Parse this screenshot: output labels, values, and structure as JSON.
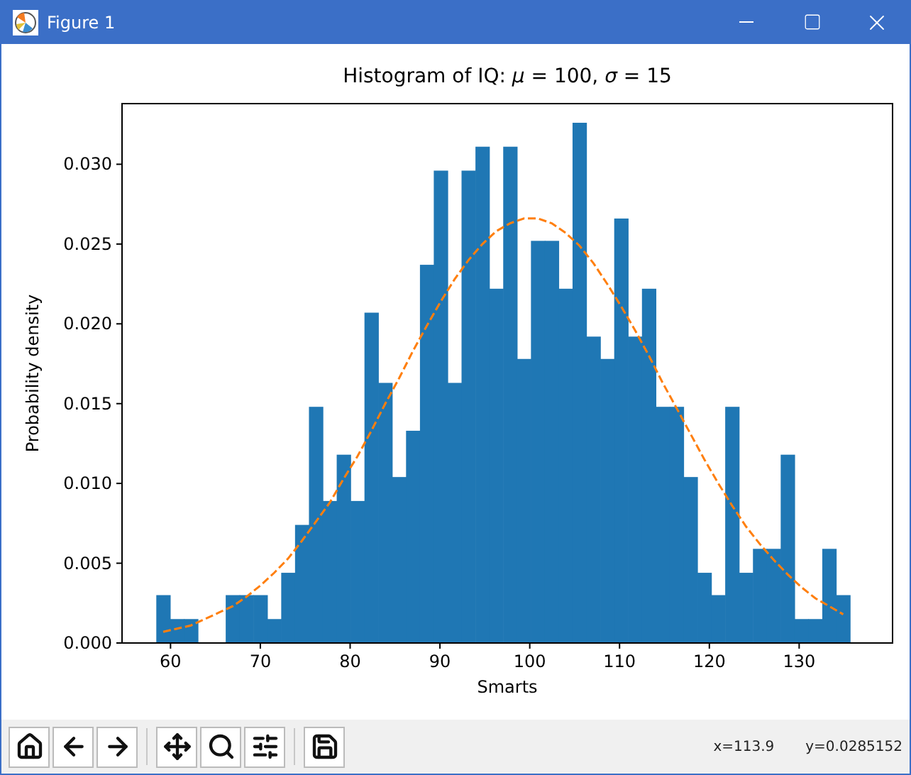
{
  "window": {
    "title": "Figure 1"
  },
  "figure": {
    "chart_data": {
      "type": "bar",
      "title": "Histogram of IQ: *μ* = 100, *σ* = 15",
      "xlabel": "Smarts",
      "ylabel": "Probability density",
      "x": [
        59.19,
        60.74,
        62.28,
        63.83,
        65.37,
        66.92,
        68.46,
        70.01,
        71.55,
        73.1,
        74.64,
        76.19,
        77.73,
        79.28,
        80.82,
        82.37,
        83.91,
        85.46,
        87.0,
        88.55,
        90.09,
        91.64,
        93.18,
        94.73,
        96.27,
        97.82,
        99.36,
        100.91,
        102.45,
        104.0,
        105.54,
        107.09,
        108.63,
        110.18,
        111.72,
        113.27,
        114.81,
        116.36,
        117.9,
        119.45,
        120.99,
        122.54,
        124.08,
        125.63,
        127.17,
        128.72,
        130.26,
        131.81,
        133.35,
        134.9
      ],
      "series": [
        {
          "color": "#1f77b4",
          "values": [
            0.003,
            0.0015,
            0.0015,
            0,
            0,
            0.003,
            0.003,
            0.003,
            0.0015,
            0.0044,
            0.0074,
            0.0148,
            0.0089,
            0.0118,
            0.0089,
            0.0207,
            0.0163,
            0.0104,
            0.0133,
            0.0237,
            0.0296,
            0.0163,
            0.0296,
            0.0311,
            0.0222,
            0.0311,
            0.0178,
            0.0252,
            0.0252,
            0.0222,
            0.0326,
            0.0192,
            0.0178,
            0.0266,
            0.0192,
            0.0222,
            0.0148,
            0.0148,
            0.0104,
            0.0044,
            0.003,
            0.0148,
            0.0044,
            0.0059,
            0.0059,
            0.0118,
            0.0015,
            0.0015,
            0.0059,
            0.003
          ]
        },
        {
          "type": "line",
          "line_style": "dashed",
          "color": "#ff7f0e",
          "values": [
            0.0007,
            0.0009,
            0.0011,
            0.0015,
            0.0019,
            0.0023,
            0.0029,
            0.0036,
            0.0044,
            0.0053,
            0.0064,
            0.0076,
            0.0088,
            0.0103,
            0.0117,
            0.0133,
            0.015,
            0.0166,
            0.0183,
            0.0199,
            0.0214,
            0.0228,
            0.024,
            0.025,
            0.0258,
            0.0263,
            0.0266,
            0.0266,
            0.0263,
            0.0257,
            0.0249,
            0.0238,
            0.0225,
            0.0211,
            0.0196,
            0.018,
            0.0163,
            0.0147,
            0.0131,
            0.0115,
            0.01,
            0.0086,
            0.0073,
            0.0062,
            0.0052,
            0.0043,
            0.0035,
            0.0028,
            0.0023,
            0.0018
          ]
        }
      ],
      "xlim": [
        54.6,
        140.4
      ],
      "ylim": [
        0,
        0.0338
      ],
      "xticks": [
        60,
        70,
        80,
        90,
        100,
        110,
        120,
        130
      ],
      "yticks": [
        {
          "value": 0,
          "label": "0.000"
        },
        {
          "value": 0.005,
          "label": "0.005"
        },
        {
          "value": 0.01,
          "label": "0.010"
        },
        {
          "value": 0.015,
          "label": "0.015"
        },
        {
          "value": 0.02,
          "label": "0.020"
        },
        {
          "value": 0.025,
          "label": "0.025"
        },
        {
          "value": 0.03,
          "label": "0.030"
        }
      ]
    }
  },
  "status": {
    "x": "x=113.9",
    "y": "y=0.0285152"
  }
}
